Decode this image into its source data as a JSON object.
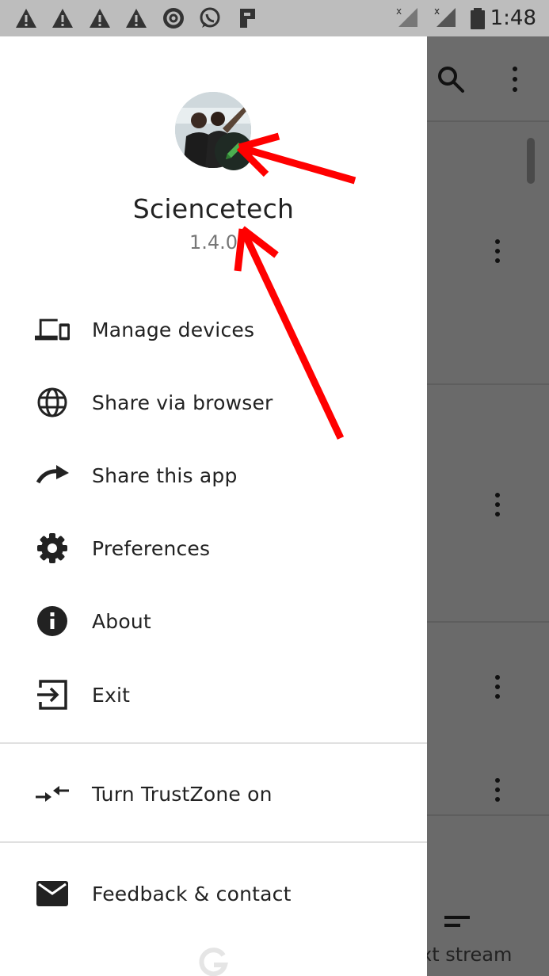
{
  "status_bar": {
    "time": "1:48",
    "icons": [
      "warning-icon",
      "warning-icon",
      "warning-icon",
      "warning-icon",
      "shield-app-icon",
      "whatsapp-icon",
      "p-app-icon",
      "no-signal-icon",
      "no-signal-icon",
      "battery-icon"
    ]
  },
  "profile": {
    "name": "Sciencetech",
    "version": "1.4.0"
  },
  "menu": {
    "items": [
      {
        "label": "Manage devices",
        "icon": "devices-icon"
      },
      {
        "label": "Share via browser",
        "icon": "globe-icon"
      },
      {
        "label": "Share this app",
        "icon": "share-arrow-icon"
      },
      {
        "label": "Preferences",
        "icon": "gear-icon"
      },
      {
        "label": "About",
        "icon": "info-icon"
      },
      {
        "label": "Exit",
        "icon": "exit-icon"
      }
    ],
    "trustzone": {
      "label": "Turn TrustZone on",
      "icon": "trustzone-icon"
    },
    "feedback": {
      "label": "Feedback & contact",
      "icon": "mail-icon"
    }
  },
  "background_app": {
    "bottom_text": "xt stream"
  },
  "colors": {
    "annotation_arrow": "#ff0000",
    "drawer_bg": "#ffffff",
    "scrim": "#6b6b6b",
    "edit_accent": "#4caf50"
  }
}
